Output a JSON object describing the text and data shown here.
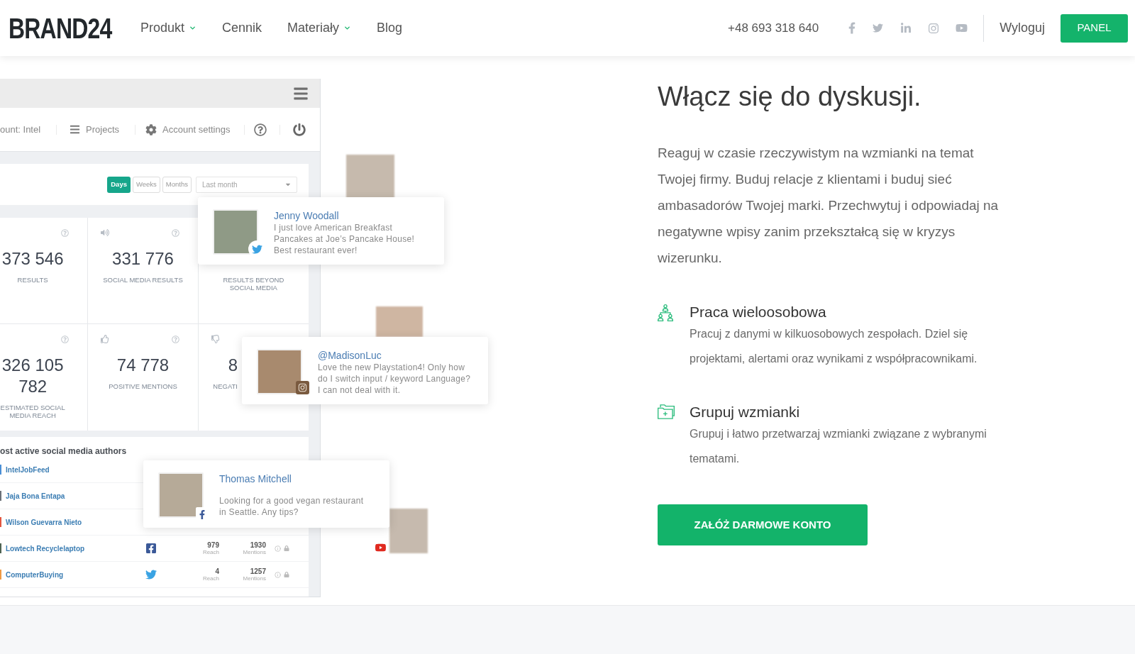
{
  "header": {
    "logo": "BRAND24",
    "nav": [
      {
        "label": "Produkt",
        "dropdown": true
      },
      {
        "label": "Cennik",
        "dropdown": false
      },
      {
        "label": "Materiały",
        "dropdown": true
      },
      {
        "label": "Blog",
        "dropdown": false
      }
    ],
    "phone": "+48 693 318 640",
    "logout": "Wyloguj",
    "panel_button": "PANEL"
  },
  "dashboard": {
    "toolbar": {
      "account": "ount: Intel",
      "projects": "Projects",
      "settings": "Account settings"
    },
    "period_tabs": [
      {
        "label": "Days",
        "selected": true
      },
      {
        "label": "Weeks",
        "selected": false
      },
      {
        "label": "Months",
        "selected": false
      }
    ],
    "range_select": {
      "value": "Last month"
    },
    "stats": [
      {
        "kind": "results",
        "value": "373 546",
        "label": "RESULTS"
      },
      {
        "kind": "social",
        "value": "331 776",
        "label": "SOCIAL MEDIA RESULTS"
      },
      {
        "kind": "beyond",
        "label": "RESULTS BEYOND SOCIAL MEDIA"
      },
      {
        "kind": "reach",
        "value": "326 105 782",
        "label": "ESTIMATED SOCIAL MEDIA REACH"
      },
      {
        "kind": "positive",
        "value": "74 778",
        "label": "POSITIVE MENTIONS"
      },
      {
        "kind": "negative",
        "value": "8",
        "label": "NEGATI"
      }
    ],
    "authors": {
      "title": "ost active social media authors",
      "rows": [
        {
          "name": "IntelJobFeed",
          "color": "#4a8fd6"
        },
        {
          "name": "Jaja Bona Entapa",
          "color": "#6b7178"
        },
        {
          "name": "Wilson Guevarra Nieto",
          "color": "#e2553f"
        },
        {
          "name": "Lowtech Recyclelaptop",
          "color": "#4e6352",
          "kind": "facebook",
          "reach": "979",
          "reach_label": "Reach",
          "mentions": "1930",
          "mentions_label": "Mentions"
        },
        {
          "name": "ComputerBuying",
          "color": "#ef9a45",
          "kind": "twitter",
          "reach": "4",
          "reach_label": "Reach",
          "mentions": "1257",
          "mentions_label": "Mentions"
        }
      ]
    }
  },
  "posts": [
    {
      "kind": "twitter",
      "author": "Jenny Woodall",
      "text": "I just love American Breakfast Pancakes at Joe’s Pancake House! Best restaurant ever!"
    },
    {
      "kind": "instagram",
      "author": "@MadisonLuc",
      "text": "Love the new Playstation4! Only how do I switch input / keyword Language? I can not deal with it."
    },
    {
      "kind": "facebook",
      "author": "Thomas Mitchell",
      "text": "Looking for a good vegan restaurant in Seattle. Any tips?"
    }
  ],
  "intro": {
    "heading": "Włącz się do dyskusji.",
    "paragraph": "Reaguj w czasie rzeczywistym na wzmianki na temat Twojej firmy. Buduj relacje z klientami i buduj sieć ambasadorów Twojej marki. Przechwytuj i odpowiadaj na negatywne wpisy zanim przekształcą się w kryzys wizerunku."
  },
  "features": [
    {
      "kind": "team",
      "title": "Praca wieloosobowa",
      "text": "Pracuj z danymi w kilkuosobowych zespołach. Dziel się projektami, alertami oraz wynikami z współpracownikami."
    },
    {
      "kind": "groups",
      "title": "Grupuj wzmianki",
      "text": "Grupuj i łatwo przetwarzaj wzmianki związane z wybranymi tematami."
    }
  ],
  "cta": {
    "label": "ZAŁÓŻ DARMOWE KONTO"
  }
}
